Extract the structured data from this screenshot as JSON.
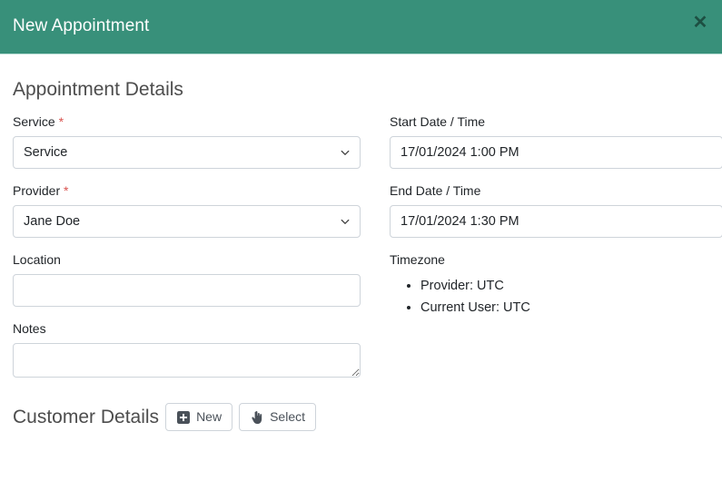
{
  "modal": {
    "title": "New Appointment",
    "close_icon": "close-icon",
    "close_glyph": "✕",
    "header_color": "#38907a"
  },
  "appointment_section": {
    "heading": "Appointment Details",
    "service": {
      "label": "Service",
      "required_mark": "*",
      "value": "Service",
      "chevron_icon": "chevron-down-icon"
    },
    "provider": {
      "label": "Provider",
      "required_mark": "*",
      "value": "Jane Doe",
      "chevron_icon": "chevron-down-icon"
    },
    "location": {
      "label": "Location",
      "value": "",
      "placeholder": ""
    },
    "notes": {
      "label": "Notes",
      "value": "",
      "placeholder": ""
    },
    "start_date": {
      "label": "Start Date / Time",
      "value": "17/01/2024 1:00 PM"
    },
    "end_date": {
      "label": "End Date / Time",
      "value": "17/01/2024 1:30 PM"
    },
    "timezone": {
      "label": "Timezone",
      "items": [
        "Provider: UTC",
        "Current User: UTC"
      ]
    }
  },
  "customer_section": {
    "heading": "Customer Details",
    "new_button": {
      "label": "New",
      "icon": "plus-square-icon"
    },
    "select_button": {
      "label": "Select",
      "icon": "hand-pointer-icon"
    }
  }
}
